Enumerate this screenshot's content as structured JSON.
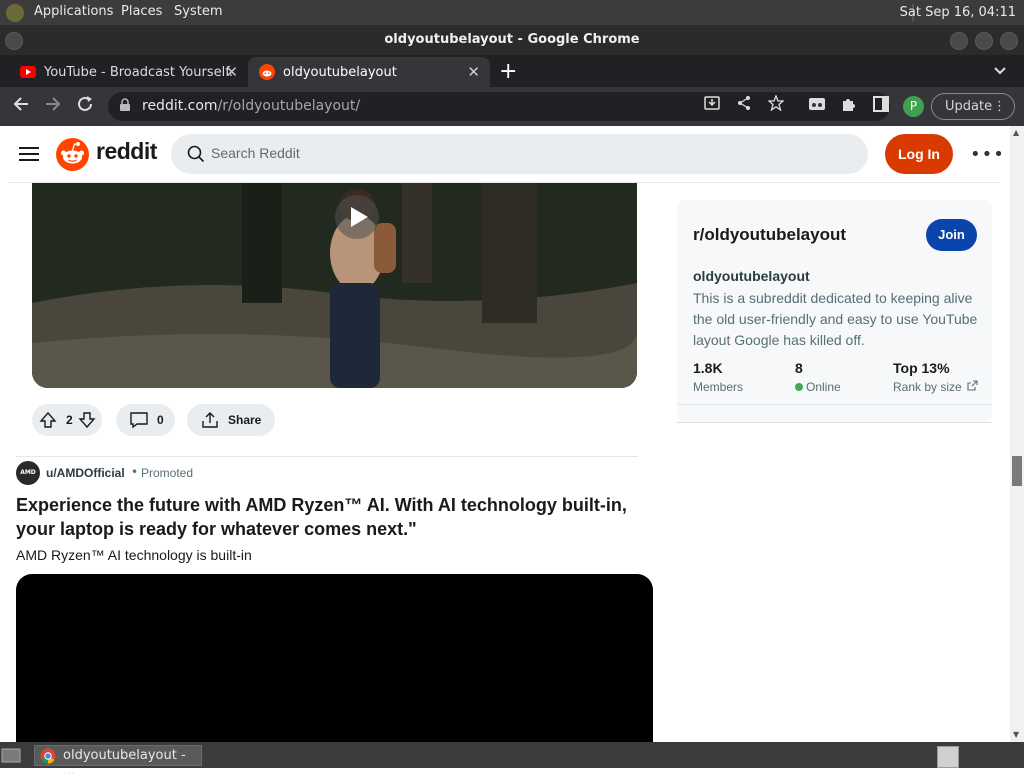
{
  "os": {
    "menus": [
      "Applications",
      "Places",
      "System"
    ],
    "clock": "Sat Sep 16, 04:11"
  },
  "window": {
    "title": "oldyoutubelayout - Google Chrome"
  },
  "tabs": [
    {
      "label": "YouTube - Broadcast Yourself."
    },
    {
      "label": "oldyoutubelayout"
    }
  ],
  "toolbar": {
    "url_host": "reddit.com",
    "url_path": "/r/oldyoutubelayout/",
    "profile_initial": "P",
    "update_label": "Update"
  },
  "reddit": {
    "wordmark": "reddit",
    "search_placeholder": "Search Reddit",
    "login_label": "Log In",
    "post1": {
      "votes": "2",
      "comments": "0",
      "share_label": "Share"
    },
    "promo": {
      "avatar_text": "AMD",
      "user": "u/AMDOfficial",
      "separator": "•",
      "tag": "Promoted",
      "title": "Experience the future with AMD Ryzen™ AI. With AI technology built-in, your laptop is ready for whatever comes next.\"",
      "subtitle": "AMD Ryzen™ AI technology is built-in"
    },
    "sidebar": {
      "name": "r/oldyoutubelayout",
      "join_label": "Join",
      "title": "oldyoutubelayout",
      "description": "This is a subreddit dedicated to keeping alive the old user-friendly and easy to use YouTube layout Google has killed off.",
      "members_value": "1.8K",
      "members_label": "Members",
      "online_value": "8",
      "online_label": "Online",
      "rank_value": "Top 13%",
      "rank_label": "Rank by size"
    }
  },
  "taskbar": {
    "item_label": "oldyoutubelayout - ..."
  },
  "colors": {
    "reddit_orange": "#ff4500",
    "login_bg": "#d93a00",
    "join_bg": "#0a45ac",
    "online_dot": "#46a758"
  }
}
